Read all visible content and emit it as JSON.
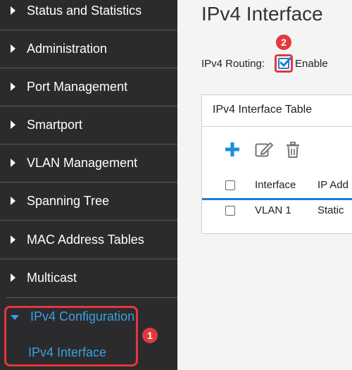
{
  "sidebar": {
    "items": [
      {
        "label": "Status and Statistics"
      },
      {
        "label": "Administration"
      },
      {
        "label": "Port Management"
      },
      {
        "label": "Smartport"
      },
      {
        "label": "VLAN Management"
      },
      {
        "label": "Spanning Tree"
      },
      {
        "label": "MAC Address Tables"
      },
      {
        "label": "Multicast"
      },
      {
        "label": "IPv4 Configuration"
      }
    ],
    "sub_item": "IPv4 Interface",
    "badge_1": "1"
  },
  "main": {
    "title": "IPv4 Interface",
    "routing_label": "IPv4 Routing:",
    "enable_label": "Enable",
    "enable_checked": true,
    "badge_2": "2",
    "table": {
      "title": "IPv4 Interface Table",
      "columns": [
        "Interface",
        "IP Add"
      ],
      "rows": [
        {
          "interface": "VLAN 1",
          "ip": "Static"
        }
      ]
    }
  },
  "colors": {
    "sidebar_bg": "#2b2b2d",
    "accent_blue": "#3aa0e0",
    "highlight_red": "#e2393d"
  },
  "icons": [
    "chevron-right-icon",
    "chevron-down-icon",
    "add-icon",
    "edit-icon",
    "delete-icon",
    "checkbox-icon"
  ]
}
